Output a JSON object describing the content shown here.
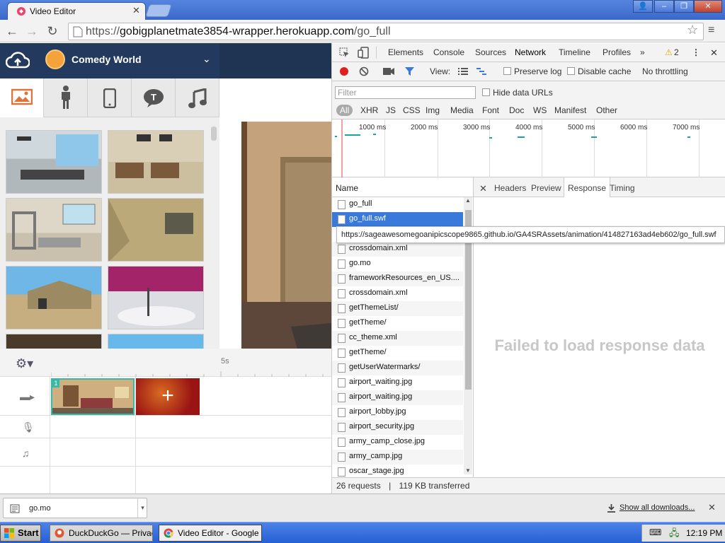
{
  "browser": {
    "tab_title": "Video Editor",
    "url_prefix": "https://",
    "url_domain": "gobigplanetmate3854-wrapper.herokuapp.com",
    "url_path": "/go_full"
  },
  "app": {
    "theme_name": "Comedy World",
    "categories": [
      "image-icon",
      "person-icon",
      "phone-icon",
      "speech-icon",
      "music-icon"
    ],
    "ruler_label": "5s",
    "zoom_icon": "zoom-in-icon"
  },
  "devtools": {
    "tabs": [
      "Elements",
      "Console",
      "Sources",
      "Network",
      "Timeline",
      "Profiles"
    ],
    "active_tab": "Network",
    "warnings": "2",
    "toolbar": {
      "view": "View:",
      "preserve_log": "Preserve log",
      "disable_cache": "Disable cache",
      "throttle": "No throttling"
    },
    "filter_placeholder": "Filter",
    "hide_data_urls": "Hide data URLs",
    "types": [
      "All",
      "XHR",
      "JS",
      "CSS",
      "Img",
      "Media",
      "Font",
      "Doc",
      "WS",
      "Manifest",
      "Other"
    ],
    "overview_labels": [
      "1000 ms",
      "2000 ms",
      "3000 ms",
      "4000 ms",
      "5000 ms",
      "6000 ms",
      "7000 ms"
    ],
    "name_header": "Name",
    "detail_tabs": [
      "Headers",
      "Preview",
      "Response",
      "Timing"
    ],
    "active_detail_tab": "Response",
    "requests": [
      "go_full",
      "go_full.swf",
      "",
      "crossdomain.xml",
      "go.mo",
      "frameworkResources_en_US....",
      "crossdomain.xml",
      "getThemeList/",
      "getTheme/",
      "cc_theme.xml",
      "getTheme/",
      "getUserWatermarks/",
      "airport_waiting.jpg",
      "airport_waiting.jpg",
      "airport_lobby.jpg",
      "airport_security.jpg",
      "army_camp_close.jpg",
      "army_camp.jpg",
      "oscar_stage.jpg"
    ],
    "selected_request": "go_full.swf",
    "tooltip": "https://sageawesomegoanipicscope9865.github.io/GA4SRAssets/animation/414827163ad4eb602/go_full.swf",
    "fail_message": "Failed to load response data",
    "status_requests": "26 requests",
    "status_sep": "|",
    "status_transferred": "119 KB transferred"
  },
  "downloads": {
    "file": "go.mo",
    "show_all": "Show all downloads..."
  },
  "taskbar": {
    "start": "Start",
    "tasks": [
      "DuckDuckGo — Privac...",
      "Video Editor - Google ..."
    ],
    "clock": "12:19 PM"
  },
  "colors": {
    "accent": "#3879d9",
    "app_header": "#233a5e",
    "clip_border": "#36b9a7",
    "record": "#e02020"
  }
}
